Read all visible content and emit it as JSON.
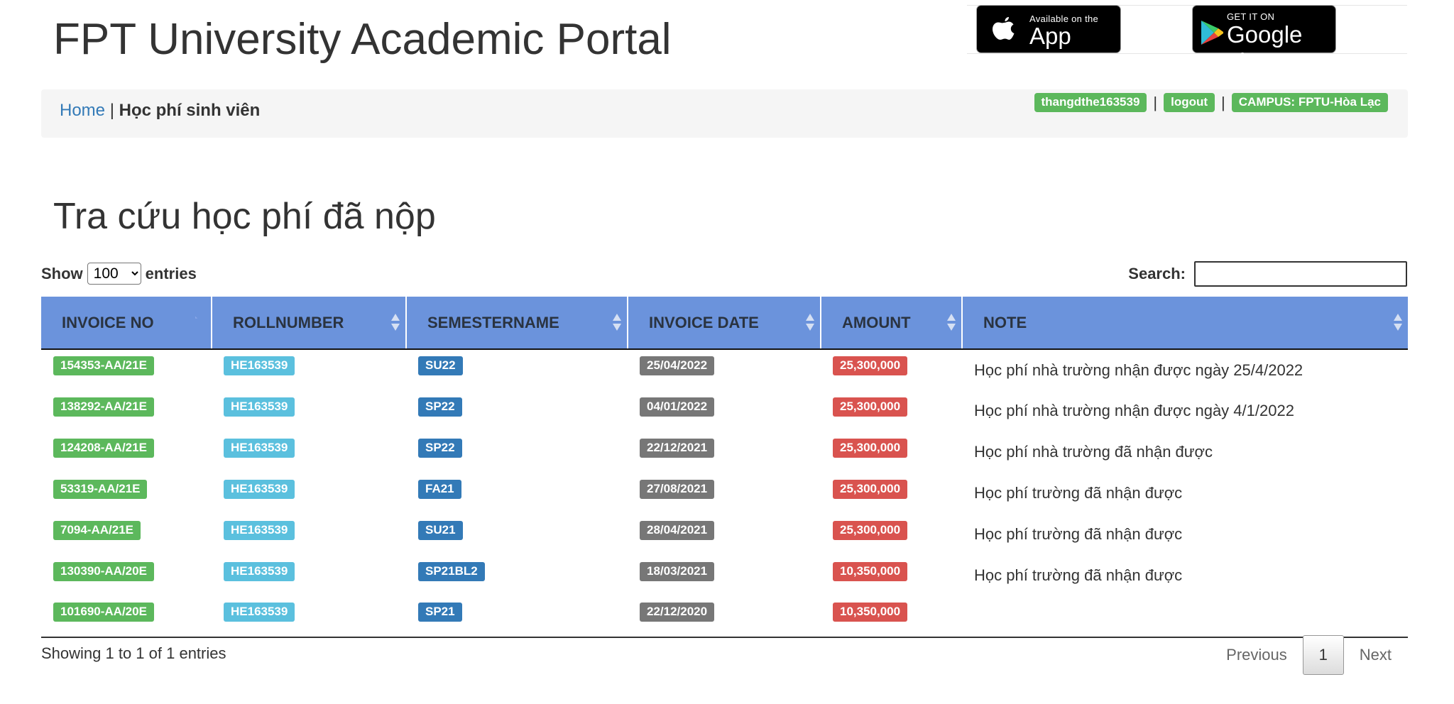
{
  "header": {
    "title": "FPT University Academic Portal",
    "appstore": {
      "small": "Available on the",
      "big": "App Store"
    },
    "googleplay": {
      "small": "GET IT ON",
      "big": "Google play"
    }
  },
  "nav": {
    "home": "Home",
    "separator": "|",
    "current": "Học phí sinh viên",
    "user": "thangdthe163539",
    "logout": "logout",
    "campus": "CAMPUS: FPTU-Hòa Lạc"
  },
  "page_title": "Tra cứu học phí đã nộp",
  "controls": {
    "show_label": "Show",
    "entries_label": "entries",
    "page_size": "100",
    "search_label": "Search:",
    "search_value": ""
  },
  "table": {
    "columns": [
      "INVOICE NO",
      "ROLLNUMBER",
      "SEMESTERNAME",
      "INVOICE DATE",
      "AMOUNT",
      "NOTE"
    ],
    "rows": [
      {
        "invoice": "154353-AA/21E",
        "roll": "HE163539",
        "semester": "SU22",
        "date": "25/04/2022",
        "amount": "25,300,000",
        "note": "Học phí nhà trường nhận được ngày 25/4/2022"
      },
      {
        "invoice": "138292-AA/21E",
        "roll": "HE163539",
        "semester": "SP22",
        "date": "04/01/2022",
        "amount": "25,300,000",
        "note": "Học phí nhà trường nhận được ngày 4/1/2022"
      },
      {
        "invoice": "124208-AA/21E",
        "roll": "HE163539",
        "semester": "SP22",
        "date": "22/12/2021",
        "amount": "25,300,000",
        "note": "Học phí nhà trường đã nhận được"
      },
      {
        "invoice": "53319-AA/21E",
        "roll": "HE163539",
        "semester": "FA21",
        "date": "27/08/2021",
        "amount": "25,300,000",
        "note": "Học phí trường đã nhận được"
      },
      {
        "invoice": "7094-AA/21E",
        "roll": "HE163539",
        "semester": "SU21",
        "date": "28/04/2021",
        "amount": "25,300,000",
        "note": "Học phí trường đã nhận được"
      },
      {
        "invoice": "130390-AA/20E",
        "roll": "HE163539",
        "semester": "SP21BL2",
        "date": "18/03/2021",
        "amount": "10,350,000",
        "note": "Học phí trường đã nhận được"
      },
      {
        "invoice": "101690-AA/20E",
        "roll": "HE163539",
        "semester": "SP21",
        "date": "22/12/2020",
        "amount": "10,350,000",
        "note": ""
      }
    ]
  },
  "footer": {
    "info": "Showing 1 to 1 of 1 entries",
    "previous": "Previous",
    "current_page": "1",
    "next": "Next"
  }
}
